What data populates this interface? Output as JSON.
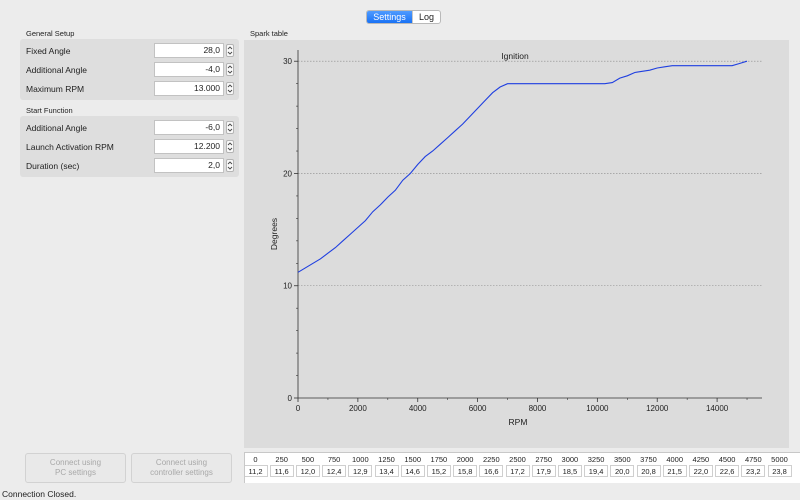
{
  "tabs": [
    {
      "label": "Settings",
      "active": true
    },
    {
      "label": "Log",
      "active": false
    }
  ],
  "general_setup": {
    "title": "General Setup",
    "fields": [
      {
        "label": "Fixed Angle",
        "value": "28,0"
      },
      {
        "label": "Additional Angle",
        "value": "-4,0"
      },
      {
        "label": "Maximum RPM",
        "value": "13.000"
      }
    ]
  },
  "start_function": {
    "title": "Start Function",
    "fields": [
      {
        "label": "Additional Angle",
        "value": "-6,0"
      },
      {
        "label": "Launch Activation RPM",
        "value": "12.200"
      },
      {
        "label": "Duration (sec)",
        "value": "2,0"
      }
    ]
  },
  "spark_table_label": "Spark table",
  "chart_data": {
    "type": "line",
    "title": "Ignition",
    "xlabel": "RPM",
    "ylabel": "Degrees",
    "xlim": [
      0,
      15500
    ],
    "ylim": [
      0,
      31
    ],
    "xticks": [
      0,
      2000,
      4000,
      6000,
      8000,
      10000,
      12000,
      14000
    ],
    "yticks": [
      0,
      10,
      20,
      30
    ],
    "grid": "horizontal-dotted",
    "series": [
      {
        "color": "#1f3fe0",
        "x": [
          0,
          250,
          500,
          750,
          1000,
          1250,
          1500,
          1750,
          2000,
          2250,
          2500,
          2750,
          3000,
          3250,
          3500,
          3750,
          4000,
          4250,
          4500,
          4750,
          5000,
          5250,
          5500,
          5750,
          6000,
          6250,
          6500,
          6750,
          7000,
          7500,
          8000,
          8500,
          9000,
          9500,
          10000,
          10250,
          10500,
          10750,
          11000,
          11250,
          11500,
          11750,
          12000,
          12250,
          12500,
          13000,
          13500,
          14000,
          14500,
          14750,
          15000
        ],
        "y": [
          11.2,
          11.6,
          12.0,
          12.4,
          12.9,
          13.4,
          14.0,
          14.6,
          15.2,
          15.8,
          16.6,
          17.2,
          17.9,
          18.5,
          19.4,
          20.0,
          20.8,
          21.5,
          22.0,
          22.6,
          23.2,
          23.8,
          24.4,
          25.1,
          25.8,
          26.5,
          27.2,
          27.7,
          28.0,
          28.0,
          28.0,
          28.0,
          28.0,
          28.0,
          28.0,
          28.0,
          28.1,
          28.5,
          28.7,
          29.0,
          29.1,
          29.2,
          29.4,
          29.5,
          29.6,
          29.6,
          29.6,
          29.6,
          29.6,
          29.8,
          30.0
        ]
      }
    ]
  },
  "buttons": {
    "connect_pc": [
      "Connect using",
      "PC settings"
    ],
    "connect_controller": [
      "Connect using",
      "controller settings"
    ]
  },
  "spark_table": {
    "rpm": [
      "0",
      "250",
      "500",
      "750",
      "1000",
      "1250",
      "1500",
      "1750",
      "2000",
      "2250",
      "2500",
      "2750",
      "3000",
      "3250",
      "3500",
      "3750",
      "4000",
      "4250",
      "4500",
      "4750",
      "5000"
    ],
    "degrees": [
      "11,2",
      "11,6",
      "12,0",
      "12,4",
      "12,9",
      "13,4",
      "14,6",
      "15,2",
      "15,8",
      "16,6",
      "17,2",
      "17,9",
      "18,5",
      "19,4",
      "20,0",
      "20,8",
      "21,5",
      "22,0",
      "22,6",
      "23,2",
      "23,8"
    ]
  },
  "status": "Connection Closed."
}
